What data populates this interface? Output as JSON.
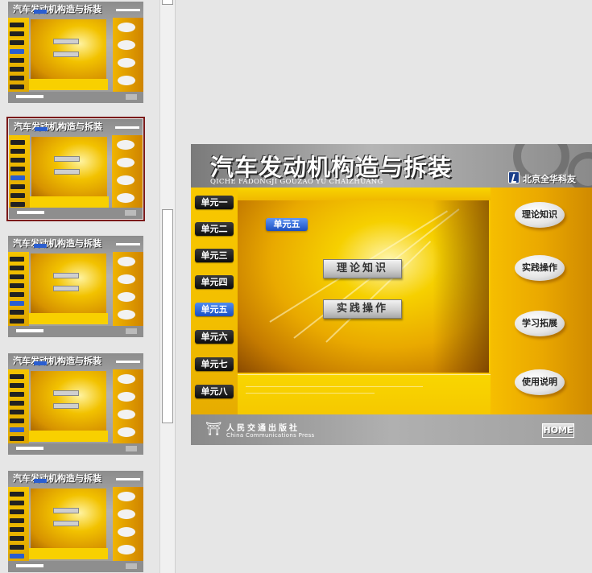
{
  "presentation": {
    "title": "汽车发动机构造与拆装",
    "subtitle": "QICHE FADONGJI GOUZAO YU CHAIZHUANG",
    "publisher_brand": "北京全华科友",
    "footer_publisher_cn": "人民交通出版社",
    "footer_publisher_en": "China Communications Press",
    "home_label": "HOME",
    "units": [
      "单元一",
      "单元二",
      "单元三",
      "单元四",
      "单元五",
      "单元六",
      "单元七",
      "单元八"
    ],
    "active_unit": "单元五",
    "center_buttons": [
      "理论知识",
      "实践操作"
    ],
    "side_buttons": [
      "理论知识",
      "实践操作",
      "学习拓展",
      "使用说明"
    ]
  },
  "colors": {
    "accent_yellow": "#f7c600",
    "active_blue": "#1c4fc0",
    "selected_thumb_border": "#7b1a1a",
    "workspace_bg": "#e6e6e6"
  },
  "thumbnails": [
    {
      "active_unit_index": 3,
      "selected": false
    },
    {
      "active_unit_index": 4,
      "selected": true
    },
    {
      "active_unit_index": 5,
      "selected": false
    },
    {
      "active_unit_index": 6,
      "selected": false
    },
    {
      "active_unit_index": 7,
      "selected": false
    }
  ]
}
